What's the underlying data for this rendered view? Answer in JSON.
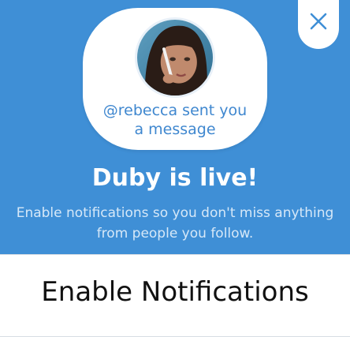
{
  "colors": {
    "hero_background": "#3f8fd6",
    "bubble_text": "#3f87cf",
    "title_text": "#ffffff",
    "subtitle_text": "#d6e8f8",
    "cta_text": "#111111"
  },
  "close_button": {
    "icon": "close-icon"
  },
  "notification_preview": {
    "avatar_icon": "user-avatar",
    "message_line1": "@rebecca sent you",
    "message_line2": "a message"
  },
  "headline": "Duby is live!",
  "description": "Enable notifications so you don't miss anything from people you follow.",
  "cta": {
    "label": "Enable Notifications"
  }
}
